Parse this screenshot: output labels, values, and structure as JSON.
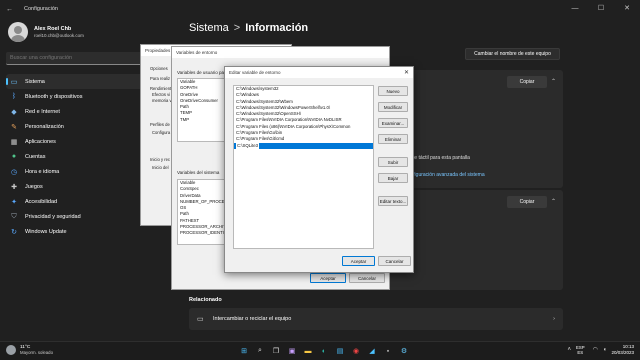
{
  "settings": {
    "app_title": "Configuración",
    "user": {
      "name": "Alex Roel Chb",
      "email": "roel10.chb@outlook.com"
    },
    "search_placeholder": "Buscar una configuración",
    "nav": [
      {
        "label": "Sistema",
        "icon": "monitor-icon",
        "active": true
      },
      {
        "label": "Bluetooth y dispositivos",
        "icon": "bluetooth-icon"
      },
      {
        "label": "Red e Internet",
        "icon": "wifi-icon"
      },
      {
        "label": "Personalización",
        "icon": "brush-icon"
      },
      {
        "label": "Aplicaciones",
        "icon": "apps-icon"
      },
      {
        "label": "Cuentas",
        "icon": "person-icon"
      },
      {
        "label": "Hora e idioma",
        "icon": "globe-clock-icon"
      },
      {
        "label": "Juegos",
        "icon": "gamepad-icon"
      },
      {
        "label": "Accesibilidad",
        "icon": "accessibility-icon"
      },
      {
        "label": "Privacidad y seguridad",
        "icon": "shield-icon"
      },
      {
        "label": "Windows Update",
        "icon": "update-icon"
      }
    ],
    "breadcrumb_parent": "Sistema",
    "breadcrumb_sep": ">",
    "breadcrumb_current": "Información",
    "rename_button": "Cambiar el nombre de este equipo",
    "copy_button_1": "Copiar",
    "copy_button_2": "Copiar",
    "visible_fragment_1": "d",
    "visible_fragment_2": "nsible táctil para esta pantalla",
    "advanced_link": "Configuración avanzada del sistema",
    "related_title": "Relacionado",
    "related_item": "Intercambiar o reciclar el equipo"
  },
  "sysprop": {
    "title": "Propiedades del sistema",
    "lines": [
      "Opciones",
      "Para realiz",
      "Rendimient",
      "Efectos vi",
      "memoria v",
      "Perfiles de",
      "Configura",
      "Inicio y rec",
      "Inicio del"
    ]
  },
  "envvars": {
    "title": "Variables de entorno",
    "user_vars_label": "Variables de usuario para",
    "user_list_header": "Variable",
    "user_vars": [
      "GOPATH",
      "OneDrive",
      "OneDriveConsumer",
      "Path",
      "TEMP",
      "TMP"
    ],
    "system_vars_label": "Variables del sistema",
    "system_list_header": "Variable",
    "system_vars": [
      "ComSpec",
      "DriverData",
      "NUMBER_OF_PROCESS",
      "OS",
      "Path",
      "PATHEXT",
      "PROCESSOR_ARCHITEC",
      "PROCESSOR_IDENTIFIE"
    ],
    "accept": "Aceptar",
    "cancel": "Cancelar"
  },
  "editdlg": {
    "title": "Editar variable de entorno",
    "close": "✕",
    "paths": [
      "C:\\Windows\\system32",
      "C:\\Windows",
      "C:\\Windows\\System32\\Wbem",
      "C:\\Windows\\System32\\WindowsPowerShell\\v1.0\\",
      "C:\\Windows\\System32\\OpenSSH\\",
      "C:\\Program Files\\NVIDIA Corporation\\NVIDIA NvDLISR",
      "C:\\Program Files (x86)\\NVIDIA Corporation\\PhysX\\Common",
      "C:\\Program Files\\Go\\bin",
      "C:\\Program Files\\Git\\cmd"
    ],
    "editing_value": "C:\\SQLite3",
    "buttons": {
      "new": "Nuevo",
      "edit": "Modificar",
      "browse": "Examinar...",
      "delete": "Eliminar",
      "up": "Subir",
      "down": "Bajar",
      "edit_text": "Editar texto..."
    },
    "accept": "Aceptar",
    "cancel": "Cancelar"
  },
  "taskbar": {
    "temperature": "11°C",
    "weather": "Mayorm. soleado",
    "lang_1": "ESP",
    "lang_2": "ES",
    "time": "10:13",
    "date": "20/03/2023"
  }
}
